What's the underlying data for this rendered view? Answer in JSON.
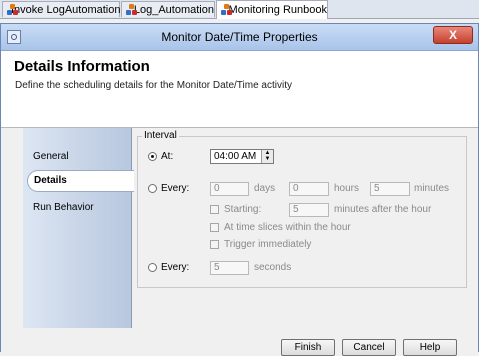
{
  "tabs": [
    {
      "label": "Invoke LogAutomation"
    },
    {
      "label": "Log_Automation"
    },
    {
      "label": "Monitoring Runbook"
    }
  ],
  "dialog": {
    "title": "Monitor Date/Time Properties",
    "close_label": "X"
  },
  "header": {
    "title": "Details Information",
    "subtitle": "Define the scheduling details for the Monitor Date/Time activity"
  },
  "sidebar": {
    "items": [
      {
        "label": "General"
      },
      {
        "label": "Details"
      },
      {
        "label": "Run Behavior"
      }
    ]
  },
  "interval": {
    "legend": "Interval",
    "at": {
      "label": "At:",
      "value": "04:00 AM"
    },
    "every1": {
      "label": "Every:",
      "days": {
        "value": "0",
        "unit": "days"
      },
      "hours": {
        "value": "0",
        "unit": "hours"
      },
      "minutes": {
        "value": "5",
        "unit": "minutes"
      }
    },
    "starting": {
      "label": "Starting:",
      "value": "5",
      "suffix": "minutes after the hour"
    },
    "time_slices": {
      "label": "At time slices within the hour"
    },
    "trigger": {
      "label": "Trigger immediately"
    },
    "every2": {
      "label": "Every:",
      "value": "5",
      "unit": "seconds"
    }
  },
  "buttons": {
    "finish": "Finish",
    "cancel": "Cancel",
    "help": "Help"
  }
}
